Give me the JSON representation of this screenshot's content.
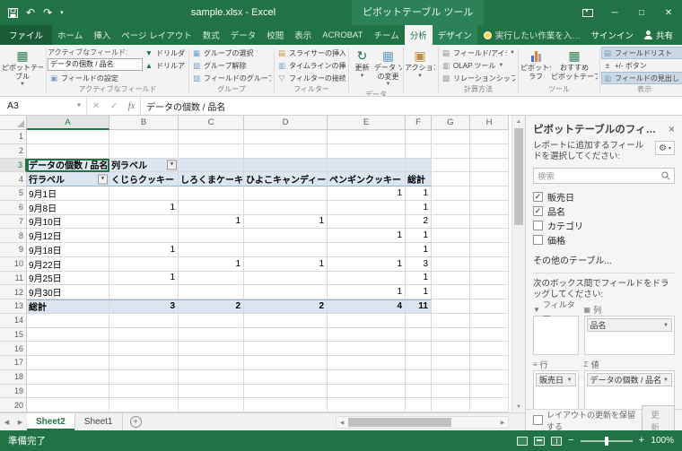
{
  "colors": {
    "excel_green": "#217346",
    "ribbon_background": "#f3f3f3",
    "pivot_header_fill": "#dce6f1",
    "pivot_border_blue": "#95b3d7",
    "gridline": "#d9d9d9"
  },
  "title_bar": {
    "title": "sample.xlsx - Excel",
    "context_title": "ピボットテーブル ツール"
  },
  "tab_row": {
    "file": "ファイル",
    "tabs": [
      "ホーム",
      "挿入",
      "ページ レイアウト",
      "数式",
      "データ",
      "校閲",
      "表示",
      "ACROBAT",
      "チーム"
    ],
    "contextual_tabs": [
      "分析",
      "デザイン"
    ],
    "active_tab": "分析",
    "tell_me": "実行したい作業を入力してください...",
    "sign_in": "サインイン",
    "share": "共有"
  },
  "ribbon": {
    "pivottable_button": {
      "line1": "ピボットテー",
      "line2": "ブル"
    },
    "active_field": {
      "group_label": "アクティブなフィールド",
      "label": "アクティブなフィールド:",
      "field_name": "データの個数 / 品名",
      "field_settings": "フィールドの設定",
      "drill_down": "ドリルダウン",
      "drill_up": "ドリルアップ"
    },
    "group_group": {
      "group_label": "グループ",
      "items": [
        {
          "name": "group-selection-button",
          "label": "グループの選択",
          "icon": "group-selection-icon"
        },
        {
          "name": "ungroup-button",
          "label": "グループ解除",
          "icon": "ungroup-icon"
        },
        {
          "name": "group-field-button",
          "label": "フィールドのグループ化",
          "icon": "group-field-icon"
        }
      ]
    },
    "filter_group": {
      "group_label": "フィルター",
      "items": [
        {
          "name": "insert-slicer-button",
          "label": "スライサーの挿入",
          "icon": "slicer-icon"
        },
        {
          "name": "insert-timeline-button",
          "label": "タイムラインの挿入",
          "icon": "timeline-icon"
        },
        {
          "name": "filter-connections-button",
          "label": "フィルターの接続",
          "icon": "filter-connections-icon"
        }
      ]
    },
    "data_group": {
      "group_label": "データ",
      "refresh": "更新",
      "change_source_line1": "データ ソース",
      "change_source_line2": "の変更"
    },
    "actions_button_label": "アクション",
    "calc_group": {
      "group_label": "計算方法",
      "items": [
        {
          "name": "fields-items-sets-button",
          "label": "フィールド/アイテム/セット",
          "icon": "fields-items-sets-icon",
          "dropdown": true
        },
        {
          "name": "olap-tools-button",
          "label": "OLAP ツール",
          "icon": "olap-tools-icon",
          "dropdown": true
        },
        {
          "name": "relationships-button",
          "label": "リレーションシップ",
          "icon": "relationships-icon"
        }
      ]
    },
    "tools_group": {
      "group_label": "ツール",
      "pivot_chart_line1": "ピボットグ",
      "pivot_chart_line2": "ラフ",
      "recommended_line1": "おすすめ",
      "recommended_line2": "ピボットテーブル"
    },
    "show_group": {
      "group_label": "表示",
      "items": [
        {
          "name": "field-list-toggle",
          "label": "フィールドリスト",
          "icon": "field-list-icon",
          "pressed": true
        },
        {
          "name": "plus-minus-buttons-toggle",
          "label": "+/- ボタン",
          "icon": "plus-minus-icon"
        },
        {
          "name": "field-headers-toggle",
          "label": "フィールドの見出し",
          "icon": "field-headers-icon",
          "pressed": true
        }
      ]
    }
  },
  "formula_bar": {
    "name_box": "A3",
    "formula": "データの個数 / 品名"
  },
  "sheet": {
    "columns": [
      "A",
      "B",
      "C",
      "D",
      "E",
      "F",
      "G",
      "H"
    ],
    "row_count": 20,
    "active_cell": "A3",
    "pivot": {
      "report_cell": "データの個数 / 品名",
      "column_labels": "列ラベル",
      "row_labels": "行ラベル",
      "column_headers": [
        "くじらクッキー",
        "しろくまケーキ",
        "ひよこキャンディー",
        "ペンギンクッキー",
        "総計"
      ],
      "rows": [
        {
          "label": "9月1日",
          "values": [
            "",
            "",
            "",
            "1",
            "1"
          ]
        },
        {
          "label": "9月8日",
          "values": [
            "1",
            "",
            "",
            "",
            "1"
          ]
        },
        {
          "label": "9月10日",
          "values": [
            "",
            "1",
            "1",
            "",
            "2"
          ]
        },
        {
          "label": "9月12日",
          "values": [
            "",
            "",
            "",
            "1",
            "1"
          ]
        },
        {
          "label": "9月18日",
          "values": [
            "1",
            "",
            "",
            "",
            "1"
          ]
        },
        {
          "label": "9月22日",
          "values": [
            "",
            "1",
            "1",
            "1",
            "3"
          ]
        },
        {
          "label": "9月25日",
          "values": [
            "1",
            "",
            "",
            "",
            "1"
          ]
        },
        {
          "label": "9月30日",
          "values": [
            "",
            "",
            "",
            "1",
            "1"
          ]
        }
      ],
      "total_row": {
        "label": "総計",
        "values": [
          "3",
          "2",
          "2",
          "4",
          "11"
        ]
      }
    }
  },
  "fields_pane": {
    "title": "ピボットテーブルのフィールド",
    "subtitle": "レポートに追加するフィールドを選択してください:",
    "search_placeholder": "検索",
    "fields": [
      {
        "name": "販売日",
        "checked": true
      },
      {
        "name": "品名",
        "checked": true
      },
      {
        "name": "カテゴリ",
        "checked": false
      },
      {
        "name": "価格",
        "checked": false
      }
    ],
    "more_tables": "その他のテーブル...",
    "drag_hint": "次のボックス間でフィールドをドラッグしてください:",
    "areas": {
      "filters": {
        "label": "フィルター",
        "items": []
      },
      "columns": {
        "label": "列",
        "items": [
          "品名"
        ]
      },
      "rows": {
        "label": "行",
        "items": [
          "販売日"
        ]
      },
      "values": {
        "label": "値",
        "items": [
          "データの個数 / 品名"
        ]
      }
    },
    "defer_layout_label": "レイアウトの更新を保留する",
    "update_button": "更新"
  },
  "sheet_tabs": {
    "tabs": [
      "Sheet2",
      "Sheet1"
    ],
    "active": "Sheet2"
  },
  "status_bar": {
    "ready": "準備完了",
    "zoom": "100%"
  }
}
